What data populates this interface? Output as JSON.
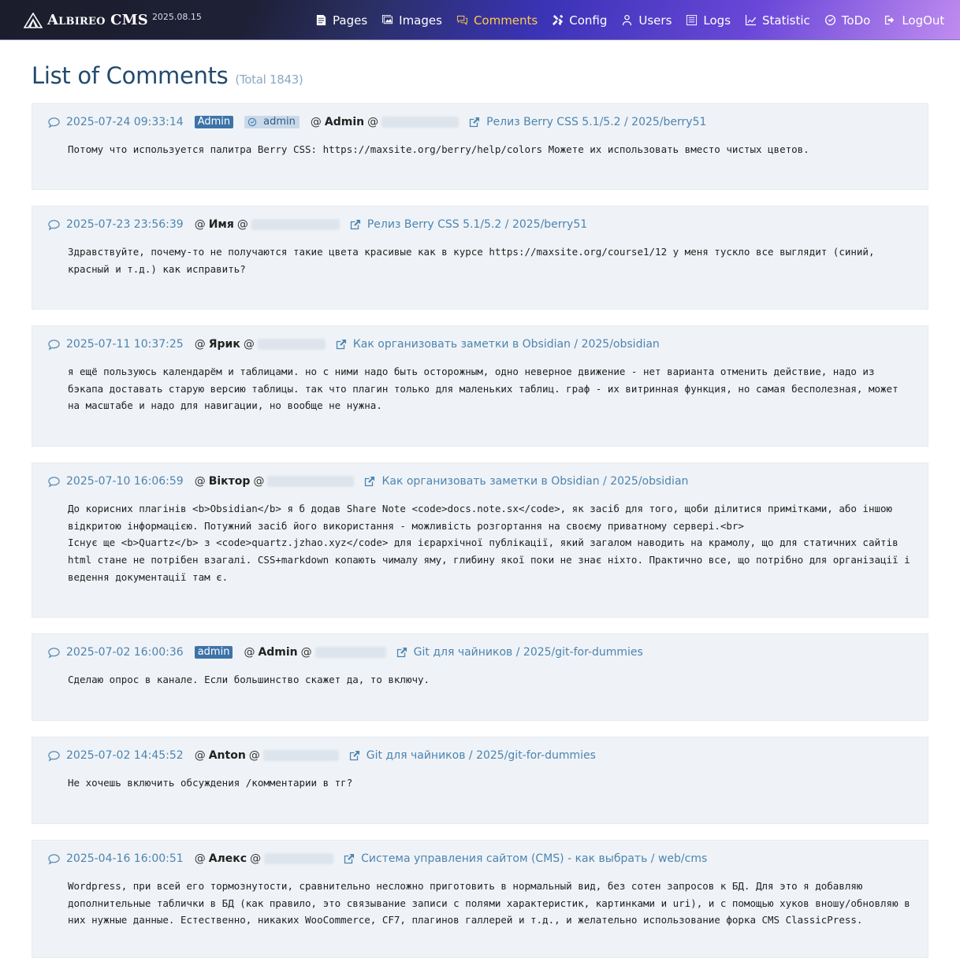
{
  "app": {
    "name": "Albireo CMS",
    "version": "2025.08.15"
  },
  "nav": [
    {
      "label": "Pages",
      "icon": "file-icon",
      "active": false
    },
    {
      "label": "Images",
      "icon": "images-icon",
      "active": false
    },
    {
      "label": "Comments",
      "icon": "comments-icon",
      "active": true
    },
    {
      "label": "Config",
      "icon": "tools-icon",
      "active": false
    },
    {
      "label": "Users",
      "icon": "user-icon",
      "active": false
    },
    {
      "label": "Logs",
      "icon": "list-icon",
      "active": false
    },
    {
      "label": "Statistic",
      "icon": "chart-icon",
      "active": false
    },
    {
      "label": "ToDo",
      "icon": "check-circle-icon",
      "active": false
    },
    {
      "label": "LogOut",
      "icon": "logout-icon",
      "active": false
    }
  ],
  "page": {
    "title": "List of Comments",
    "total": "(Total 1843)"
  },
  "colors": {
    "accent": "#4d84b0",
    "active_nav": "#ffc94b",
    "card_bg": "#eff3f7"
  },
  "comments": [
    {
      "date": "2025-07-24 09:33:14",
      "badge_admin": "Admin",
      "badge_user": "admin",
      "at": "@",
      "author": "Admin",
      "at2": "@",
      "post": "Релиз Berry CSS 5.1/5.2 / 2025/berry51",
      "text": "Потому что используется палитра Berry CSS: https://maxsite.org/berry/help/colors Можете их использовать вместо чистых цветов."
    },
    {
      "date": "2025-07-23 23:56:39",
      "at": "@",
      "author": "Имя",
      "at2": "@",
      "post": "Релиз Berry CSS 5.1/5.2 / 2025/berry51",
      "text": "Здравствуйте, почему-то не получаются такие цвета красивые как в курсе https://maxsite.org/course1/12 у меня тускло все выглядит (синий, красный и т.д.) как исправить?"
    },
    {
      "date": "2025-07-11 10:37:25",
      "at": "@",
      "author": "Ярик",
      "at2": "@",
      "post": "Как организовать заметки в Obsidian / 2025/obsidian",
      "text": "я ещё пользуюсь календарём и таблицами. но с ними надо быть осторожным, одно неверное движение - нет варианта отменить действие, надо из бэкапа доставать старую версию таблицы. так что плагин только для маленьких таблиц. граф - их витринная функция, но самая бесполезная, может на масштабе и надо для навигации, но вообще не нужна."
    },
    {
      "date": "2025-07-10 16:06:59",
      "at": "@",
      "author": "Віктор",
      "at2": "@",
      "post": "Как организовать заметки в Obsidian / 2025/obsidian",
      "text": "До корисних плагінів <b>Obsidian</b> я б додав Share Note <code>docs.note.sx</code>, як засіб для того, щоби ділитися примітками, або іншою відкритою інформацією. Потужний засіб його використання - можливість розгортання на своєму приватному сервері.<br>\nІснує ще <b>Quartz</b> з <code>quartz.jzhao.xyz</code> для ієрархічної публікації, який загалом наводить на крамолу, що для статичних сайтів html стане не потрібен взагалі. CSS+markdown копають чималу яму, глибину якої поки не знає ніхто. Практично все, що потрібно для організації і ведення документації там є."
    },
    {
      "date": "2025-07-02 16:00:36",
      "badge_admin": "admin",
      "at": "@",
      "author": "Admin",
      "at2": "@",
      "post": "Git для чайников / 2025/git-for-dummies",
      "text": "Сделаю опрос в канале. Если большинство скажет да, то включу."
    },
    {
      "date": "2025-07-02 14:45:52",
      "at": "@",
      "author": "Anton",
      "at2": "@",
      "post": "Git для чайников / 2025/git-for-dummies",
      "text": "Не хочешь включить обсуждения /комментарии в тг?"
    },
    {
      "date": "2025-04-16 16:00:51",
      "at": "@",
      "author": "Алекс",
      "at2": "@",
      "post": "Система управления сайтом (CMS) - как выбрать / web/cms",
      "text": "Wordpress, при всей его тормознутости, сравнительно несложно приготовить в нормальный вид, без сотен запросов к БД. Для это я добавляю дополнительные таблички в БД (как правило, это связывание записи с полями характеристик, картинками и uri), и с помощью хуков вношу/обновляю в них нужные данные. Естественно, никаких WooCommerce, CF7, плагинов галлерей и т.д., и желательно использование форка CMS ClassicPress."
    }
  ]
}
